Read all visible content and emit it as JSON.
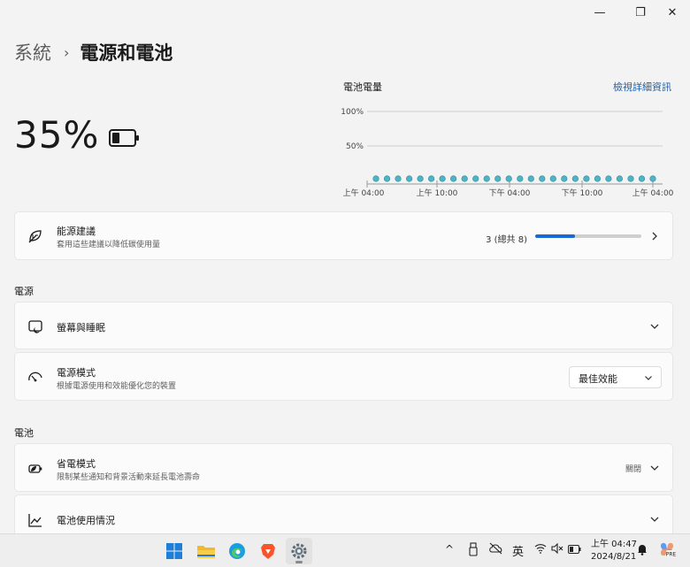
{
  "window": {
    "minimize_icon": "—",
    "maximize_icon": "❐",
    "close_icon": "✕"
  },
  "breadcrumb": {
    "parent": "系統",
    "separator": "›",
    "current": "電源和電池"
  },
  "battery": {
    "percent_text": "35%",
    "level": 0.35
  },
  "usage_chart": {
    "title": "電池電量",
    "link": "檢視詳細資訊",
    "y_labels": [
      "100%",
      "50%"
    ],
    "x_labels": [
      "上午 04:00",
      "上午 10:00",
      "下午 04:00",
      "下午 10:00",
      "上午 04:00"
    ]
  },
  "chart_data": {
    "type": "scatter",
    "title": "電池電量",
    "yticks": [
      "100%",
      "50%"
    ],
    "ylim": [
      0,
      100
    ],
    "xticks": [
      "上午 04:00",
      "上午 10:00",
      "下午 04:00",
      "下午 10:00",
      "上午 04:00"
    ],
    "series": [
      {
        "values": [
          0,
          0,
          0,
          0,
          0,
          0,
          0,
          0,
          0,
          0,
          0,
          0,
          0,
          0,
          0,
          0,
          0,
          0,
          0,
          0,
          0,
          0,
          0,
          0,
          0,
          0
        ],
        "color": "#4fb3c4"
      }
    ]
  },
  "energy_recommendations": {
    "title": "能源建議",
    "subtitle": "套用這些建議以降低碳使用量",
    "count_text": "3 (總共 8)",
    "progress": 0.375,
    "icon": "leaf-icon"
  },
  "power_section": {
    "label": "電源"
  },
  "screen_sleep": {
    "title": "螢幕與睡眠",
    "icon": "screen-sleep-icon"
  },
  "power_mode": {
    "title": "電源模式",
    "subtitle": "根據電源使用和效能優化您的裝置",
    "value": "最佳效能",
    "icon": "gauge-icon"
  },
  "battery_section": {
    "label": "電池"
  },
  "battery_saver": {
    "title": "省電模式",
    "subtitle": "限制某些通知和背景活動來延長電池壽命",
    "status": "關閉",
    "icon": "battery-saver-icon"
  },
  "battery_usage": {
    "title": "電池使用情況",
    "icon": "chart-line-icon"
  },
  "taskbar": {
    "apps": [
      "windows-start-icon",
      "file-explorer-icon",
      "edge-icon",
      "brave-icon",
      "settings-icon"
    ],
    "tray": {
      "chevron": "^",
      "ime": "英",
      "time": "上午 04:47",
      "date": "2024/8/21"
    }
  }
}
